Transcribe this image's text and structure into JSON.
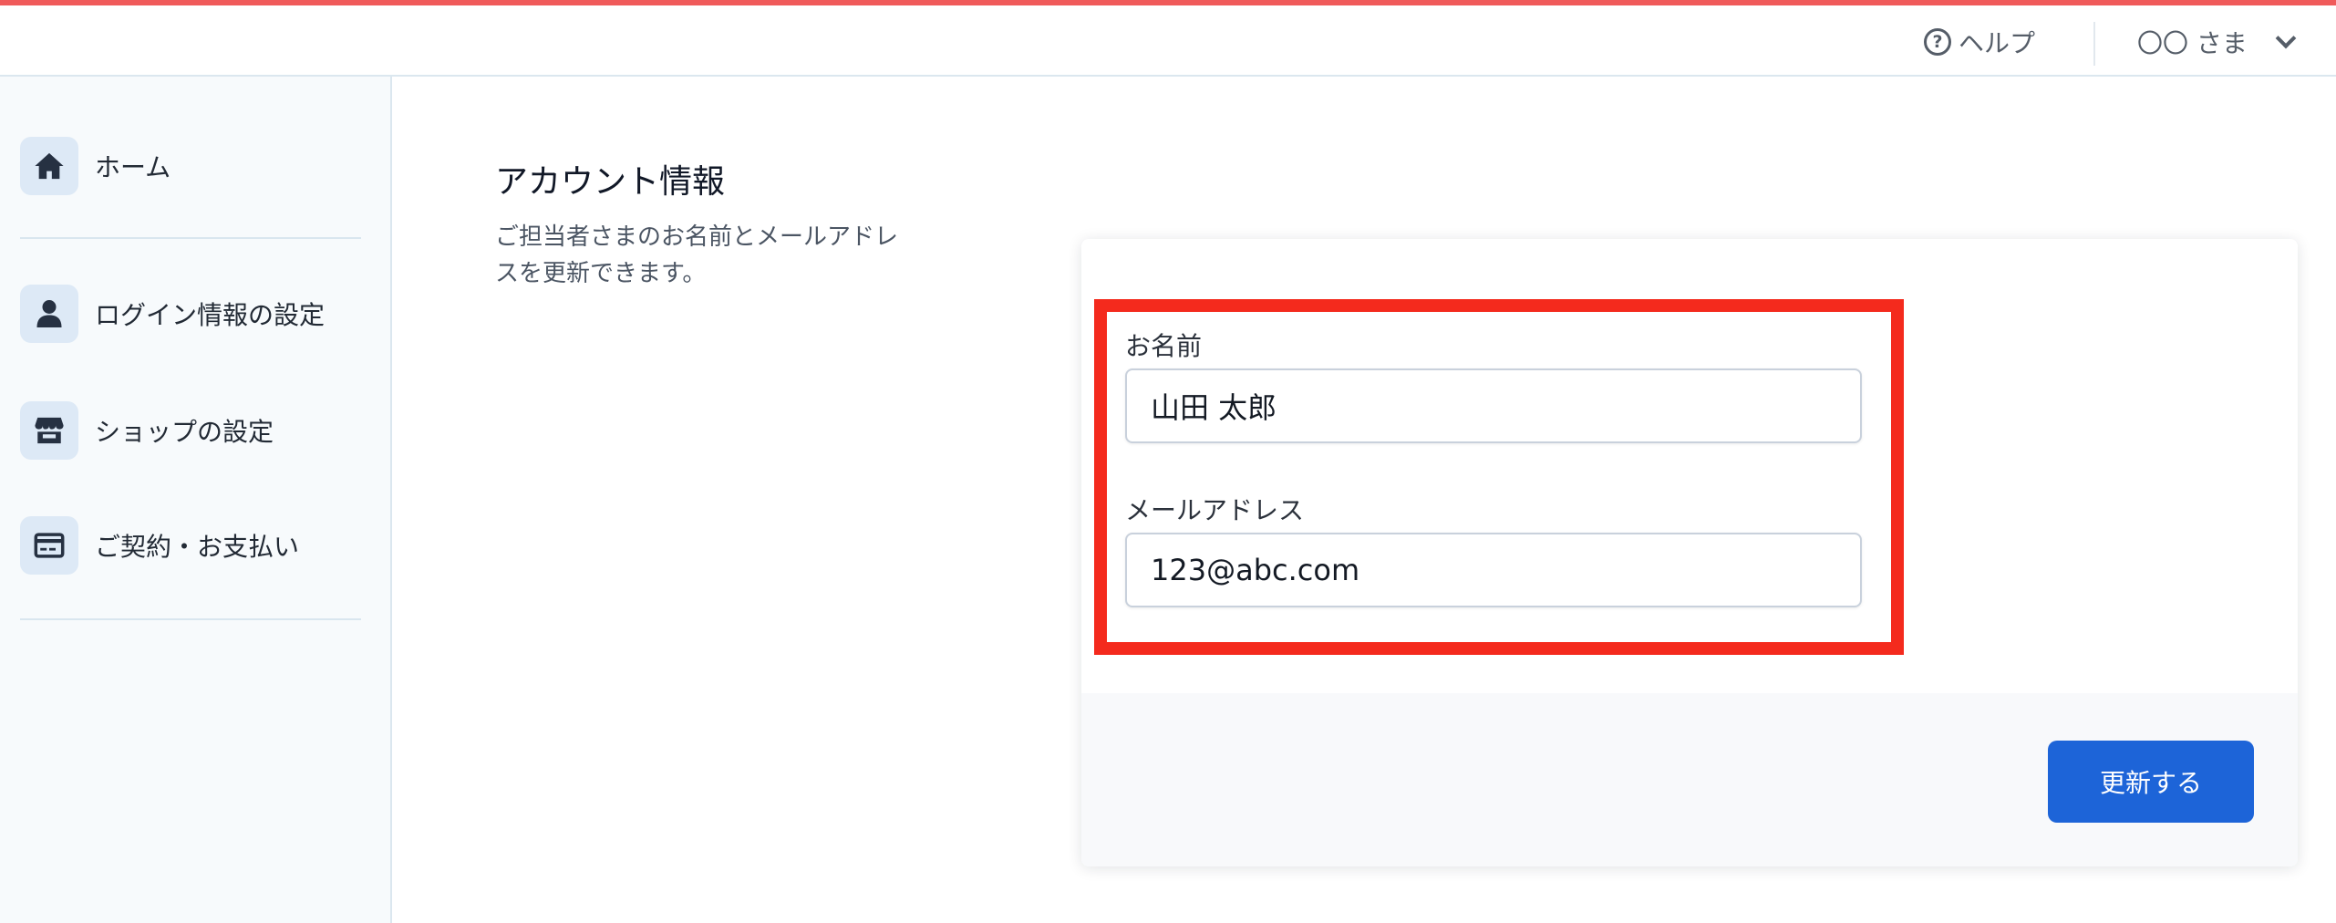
{
  "colors": {
    "accent_top": "#f05a5a",
    "primary_button": "#1d64d8",
    "highlight_border": "#f42a1d",
    "sidebar_bg": "#f7fafc",
    "nav_icon_bg": "#dde9f6"
  },
  "header": {
    "help_label": "ヘルプ",
    "help_icon": "question-circle-icon",
    "user_label": "〇〇 さま",
    "user_menu_icon": "chevron-down-icon"
  },
  "sidebar": {
    "items": [
      {
        "label": "ホーム",
        "icon": "home-icon"
      },
      {
        "label": "ログイン情報の設定",
        "icon": "user-icon"
      },
      {
        "label": "ショップの設定",
        "icon": "store-icon"
      },
      {
        "label": "ご契約・お支払い",
        "icon": "credit-card-icon"
      }
    ]
  },
  "main": {
    "title": "アカウント情報",
    "description": "ご担当者さまのお名前とメールアドレスを更新できます。",
    "form": {
      "name_label": "お名前",
      "name_value": "山田 太郎",
      "email_label": "メールアドレス",
      "email_value": "123@abc.com",
      "submit_label": "更新する"
    }
  }
}
